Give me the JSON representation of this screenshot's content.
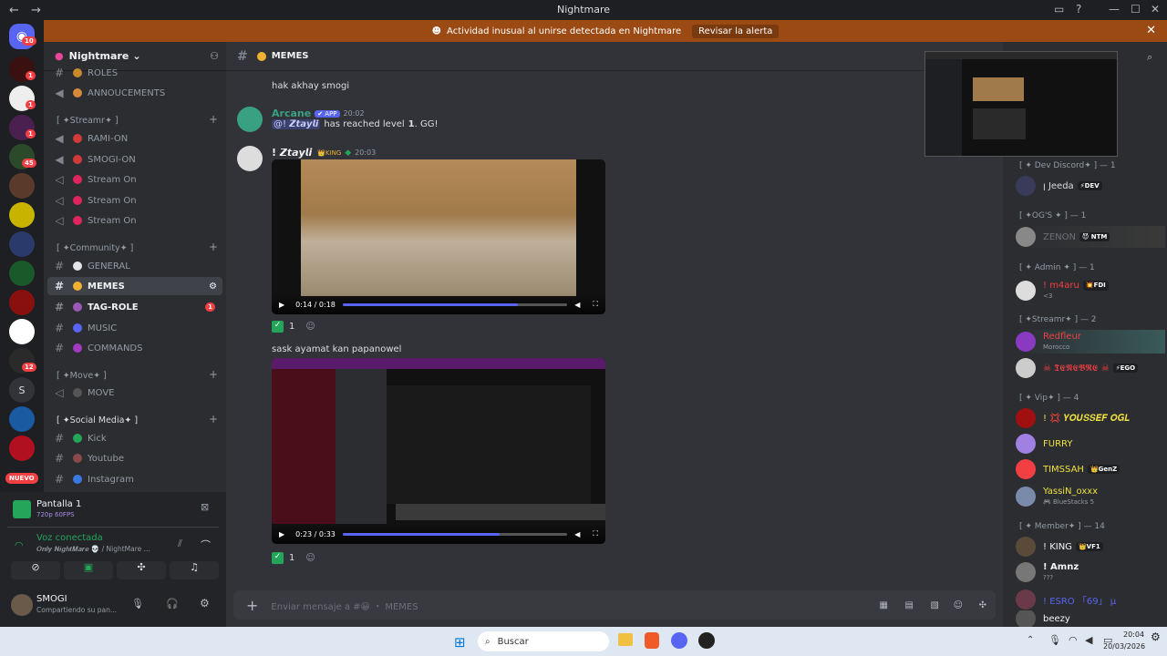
{
  "window": {
    "title": "Nightmare",
    "back": "←",
    "forward": "→"
  },
  "banner": {
    "text": "Actividad inusual al unirse detectada en Nightmare",
    "button": "Revisar la alerta",
    "close": "✕"
  },
  "rail": {
    "home_badge": "10",
    "badges": [
      "1",
      "1",
      "1",
      "45",
      "12"
    ],
    "letter_server": "S",
    "new_badge": "NUEVO"
  },
  "guild": {
    "name": "Nightmare",
    "chevron": "⌄"
  },
  "channels": {
    "roles": "ROLES",
    "announcements": "ANNOUCEMENTS",
    "cat_streamr": "[ ✦Streamr✦ ]",
    "rami_on": "RAMI-ON",
    "smogi_on": "SMOGI-ON",
    "stream_on": "Stream On",
    "cat_community": "[ ✦Community✦ ]",
    "general": "GENERAL",
    "memes": "MEMES",
    "tag_role": "TAG-ROLE",
    "tag_badge": "1",
    "music": "MUSIC",
    "commands": "COMMANDS",
    "cat_move": "[ ✦Move✦ ]",
    "move": "MOVE",
    "cat_social": "[ ✦Social Media✦ ]",
    "kick": "Kick",
    "youtube": "Youtube",
    "instagram": "Instagram"
  },
  "panel": {
    "screen_title": "Pantalla 1",
    "screen_sub": "720p 60FPS",
    "voice_title": "Voz conectada",
    "voice_sub": "𝑶𝒏𝒍𝒚 𝑵𝒊𝒈𝒉𝒕𝑴𝒂𝒓𝒆 💀 / NightMare ...",
    "user_name": "SMOGI",
    "user_status": "Compartiendo su pan..."
  },
  "channel_header": {
    "name": "MEMES"
  },
  "messages": {
    "m0_text": "hak akhay smogi",
    "m1_author": "Arcane",
    "m1_app": "✔ APP",
    "m1_time": "20:02",
    "m1_mention": "@! 𝙕𝙩𝙖𝙮𝙡𝙞",
    "m1_text1": "has reached level",
    "m1_level": "1",
    "m1_text2": ". GG!",
    "m2_author": "! 𝙕𝙩𝙖𝙮𝙡𝙞",
    "m2_tag": "👑KING",
    "m2_time": "20:03",
    "v1_time": "0:14 / 0:18",
    "v1_progress": 0.78,
    "r1_count": "1",
    "m3_text": "sask ayamat kan papanowel",
    "v2_time": "0:23 / 0:33",
    "v2_progress": 0.7,
    "r2_count": "1"
  },
  "composer": {
    "placeholder": "Enviar mensaje a #😀 ・ MEMES"
  },
  "members": {
    "g_dev": "[ ✦ Dev Discord✦ ] — 1",
    "m_jeeda": "ꞁ Jeeda",
    "m_jeeda_tag": "⚡DEV",
    "g_ogs": "[ ✦OG'S ✦ ] — 1",
    "m_zenon": "ZENON",
    "m_zenon_tag": "😈 NTM",
    "g_admin": "[ ✦ Admin ✦ ] — 1",
    "m_m4aru": "! m4aru",
    "m_m4aru_tag": "💥FDI",
    "m_m4aru_sub": "<3",
    "g_streamr": "[ ✦Streamr✦ ] — 2",
    "m_redm": "Redfleur",
    "m_redm_sub": "Morocco",
    "m_tenebre": "☠ 𝕿𝕰𝕹𝕰𝕭𝕽𝕰 ☠",
    "m_tenebre_tag": "⚡EGO",
    "g_vip": "[ ✦ Vip✦ ] — 4",
    "m_youssef": "! 💢 𝒀𝑶𝑼𝑺𝑺𝑬𝑭 𝑶𝑮𝑳",
    "m_furry": "FURRY",
    "m_timssah": "TIMSSAH",
    "m_timssah_tag": "👑GenZ",
    "m_yassin": "YassiN_oxxx",
    "m_yassin_sub": "🎮 BlueStacks 5",
    "g_member": "[ ✦ Member✦ ] — 14",
    "m_king": "! KING",
    "m_king_tag": "👑VF1",
    "m_amnz": "! Amnz",
    "m_amnz_sub": "???",
    "m_esro": "! ESRO 「69」 µ",
    "m_beezy": "beezy"
  },
  "taskbar": {
    "search": "Buscar",
    "time": "20:04",
    "date": "20/03/2026"
  },
  "colors": {
    "accent": "#5865f2",
    "banner": "#9b4a13",
    "green": "#23a55a",
    "red": "#f23f43"
  }
}
